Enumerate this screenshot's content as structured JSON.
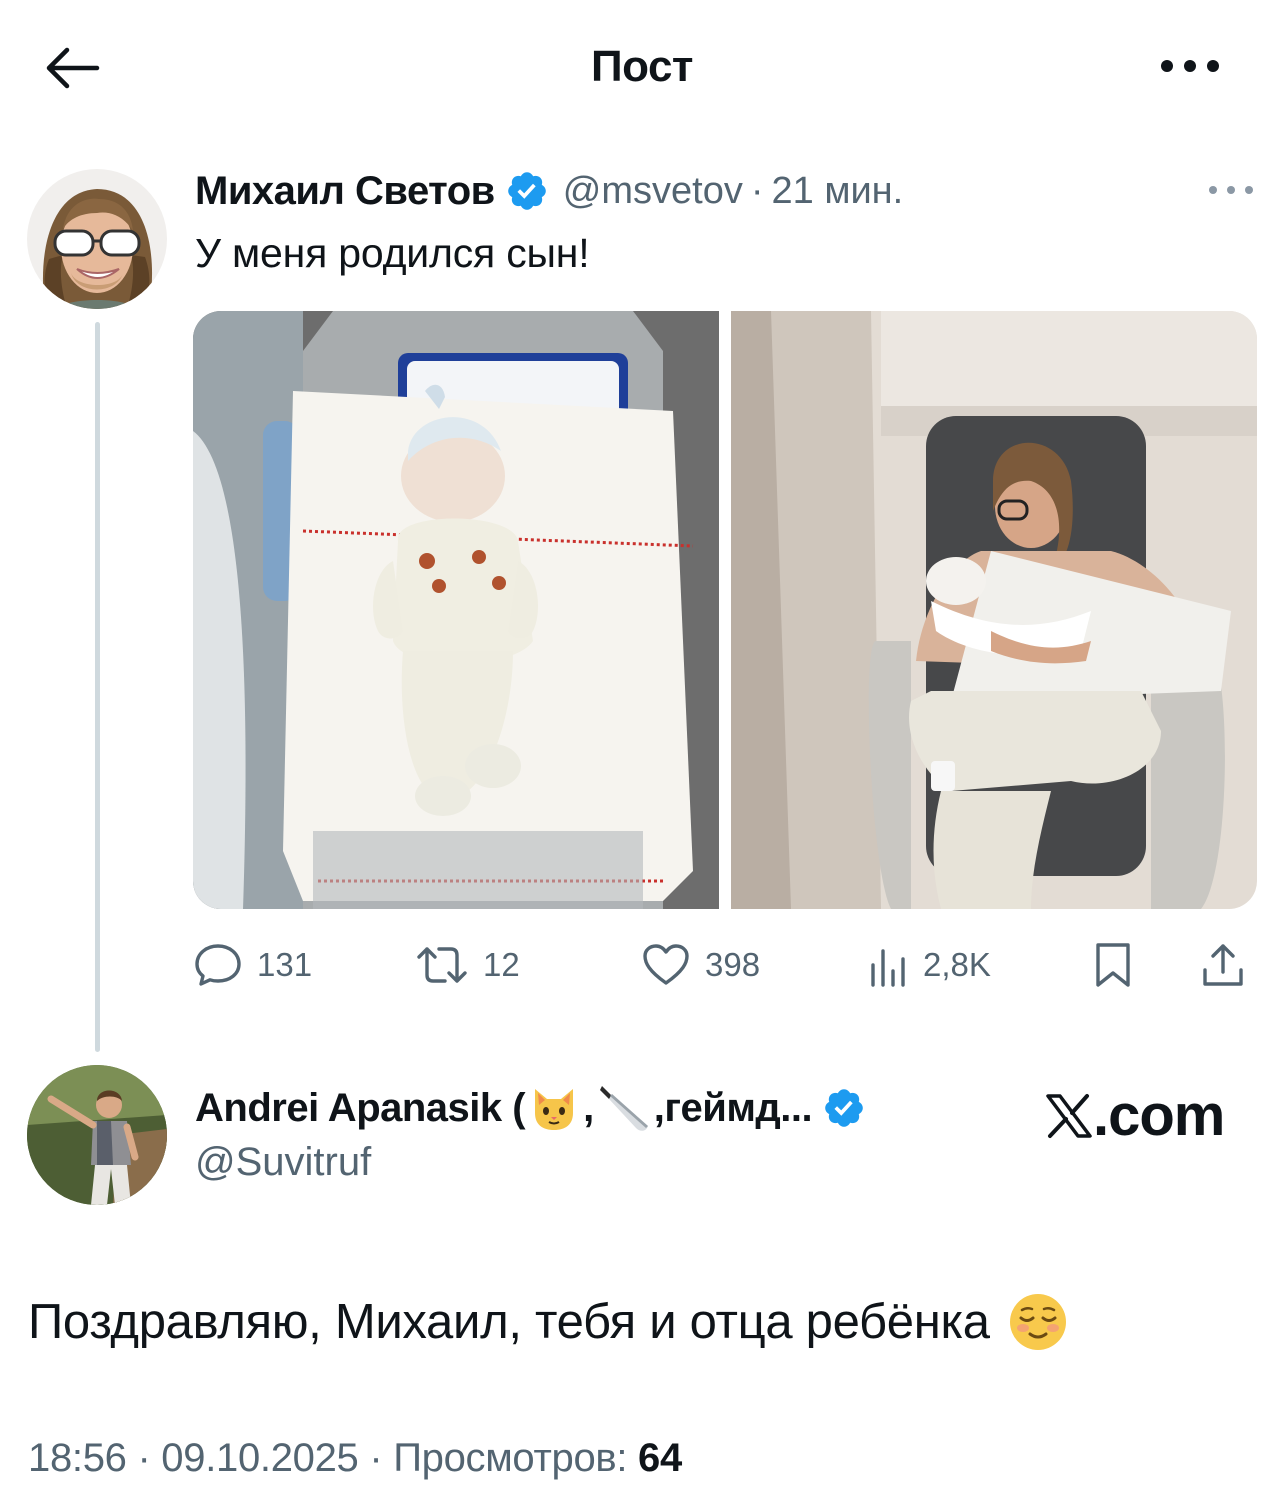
{
  "header": {
    "title": "Пост"
  },
  "tweet": {
    "author_name": "Михаил Светов",
    "handle": "@msvetov",
    "separator": "·",
    "time": "21 мин.",
    "text": "У меня родился сын!",
    "stats": {
      "replies": "131",
      "reposts": "12",
      "likes": "398",
      "views": "2,8K"
    },
    "colors": {
      "verified": "#1d9bf0",
      "secondary_text": "#536471",
      "thread_line": "#cfd9de"
    }
  },
  "reply": {
    "name_prefix": "Andrei Apanasik (",
    "name_comma": ",",
    "name_suffix": ",геймд...",
    "handle": "@Suvitruf",
    "badge_text": ".com",
    "body": "Поздравляю, Михаил, тебя и отца ребёнка",
    "emojis": [
      "cat-face",
      "kitchen-knife",
      "relieved-face"
    ]
  },
  "footer": {
    "time": "18:56",
    "separator": "·",
    "date": "09.10.2025",
    "views_label": "Просмотров:",
    "views_value": "64"
  }
}
